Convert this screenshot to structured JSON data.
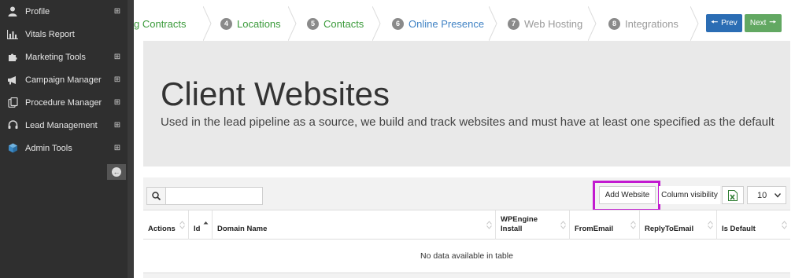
{
  "sidebar": {
    "items": [
      {
        "label": "Profile",
        "icon": "user-icon",
        "expand": "⊞"
      },
      {
        "label": "Vitals Report",
        "icon": "bar-chart-icon",
        "expand": ""
      },
      {
        "label": "Marketing Tools",
        "icon": "puzzle-icon",
        "expand": "⊞"
      },
      {
        "label": "Campaign Manager",
        "icon": "megaphone-icon",
        "expand": "⊞"
      },
      {
        "label": "Procedure Manager",
        "icon": "clipboard-icon",
        "expand": "⊞"
      },
      {
        "label": "Lead Management",
        "icon": "headset-icon",
        "expand": "⊞"
      },
      {
        "label": "Admin Tools",
        "icon": "cube-icon",
        "expand": "⊞"
      }
    ]
  },
  "wizard": {
    "steps": [
      {
        "num": "",
        "label": "g Contracts",
        "state": "done"
      },
      {
        "num": "4",
        "label": "Locations",
        "state": "done"
      },
      {
        "num": "5",
        "label": "Contacts",
        "state": "done"
      },
      {
        "num": "6",
        "label": "Online Presence",
        "state": "active"
      },
      {
        "num": "7",
        "label": "Web Hosting",
        "state": "future"
      },
      {
        "num": "8",
        "label": "Integrations",
        "state": "future"
      }
    ],
    "prev_label": "Prev",
    "next_label": "Next"
  },
  "hero": {
    "title": "Client Websites",
    "description": "Used in the lead pipeline as a source, we build and track websites and must have at least one specified as the default"
  },
  "toolbar": {
    "search_value": "",
    "add_label": "Add Website",
    "colvis_label": "Column visibility",
    "page_length": "10"
  },
  "table": {
    "columns": [
      "Actions",
      "Id",
      "Domain Name",
      "WPEngine Install",
      "FromEmail",
      "ReplyToEmail",
      "Is Default"
    ],
    "empty_message": "No data available in table"
  },
  "colors": {
    "accent": "#3f82c4",
    "done": "#3a9a3a",
    "highlight": "#c21ad0",
    "prev": "#2b6db4",
    "next": "#62a862"
  }
}
